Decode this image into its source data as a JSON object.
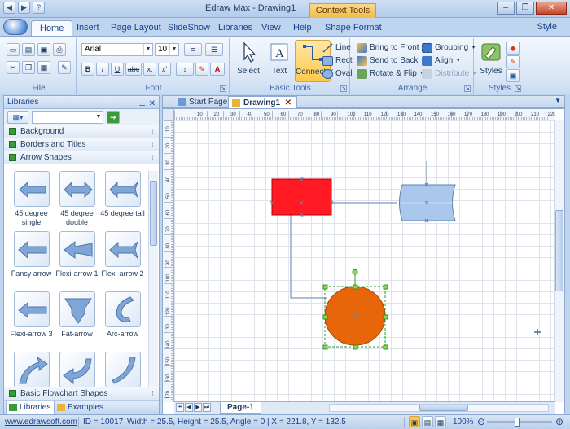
{
  "window": {
    "title": "Edraw Max - Drawing1",
    "context_tools": "Context Tools",
    "minimize": "–",
    "maximize": "❐",
    "close": "✕"
  },
  "qat": [
    "◀",
    "▶",
    "?"
  ],
  "tabs": [
    {
      "label": "Home",
      "active": true
    },
    {
      "label": "Insert"
    },
    {
      "label": "Page Layout"
    },
    {
      "label": "SlideShow"
    },
    {
      "label": "Libraries"
    },
    {
      "label": "View"
    },
    {
      "label": "Help"
    },
    {
      "label": "Shape Format"
    }
  ],
  "style_menu": "Style",
  "ribbon": {
    "file_label": "File",
    "font_label": "Font",
    "basic_tools_label": "Basic Tools",
    "arrange_label": "Arrange",
    "styles_label": "Styles",
    "font_name": "Arial",
    "font_size": "10",
    "bold": "B",
    "italic": "I",
    "underline": "U",
    "strike": "abc",
    "subscript": "x,",
    "superscript": "x'",
    "select_label": "Select",
    "text_label": "Text",
    "connector_label": "Connector",
    "line_label": "Line",
    "rect_label": "Rect",
    "oval_label": "Oval",
    "bring_front": "Bring to Front",
    "send_back": "Send to Back",
    "rotate_flip": "Rotate & Flip",
    "grouping": "Grouping",
    "align": "Align",
    "distribute": "Distribute",
    "styles_btn": "Styles"
  },
  "libraries": {
    "title": "Libraries",
    "pin": "⊥",
    "close": "✕",
    "categories": [
      "Background",
      "Borders and Titles",
      "Arrow Shapes"
    ],
    "bottom_category": "Basic Flowchart Shapes",
    "shapes": [
      "45 degree single",
      "45 degree double",
      "45 degree tail",
      "Fancy arrow",
      "Flexi-arrow 1",
      "Flexi-arrow 2",
      "Flexi-arrow 3",
      "Fat-arrow",
      "Arc-arrow",
      "",
      "",
      ""
    ],
    "tab_libraries": "Libraries",
    "tab_examples": "Examples"
  },
  "doc_tabs": [
    {
      "label": "Start Page"
    },
    {
      "label": "Drawing1",
      "active": true
    }
  ],
  "doc_tab_close": "✕",
  "page_tab": "Page-1",
  "rulers": {
    "h": [
      "10",
      "20",
      "30",
      "40",
      "50",
      "60",
      "70",
      "80",
      "90",
      "100",
      "110",
      "120",
      "130",
      "140",
      "150",
      "160",
      "170",
      "180",
      "190",
      "200",
      "210",
      "220"
    ],
    "v": [
      "10",
      "20",
      "30",
      "40",
      "50",
      "60",
      "70",
      "80",
      "90",
      "100",
      "110",
      "120",
      "130",
      "140",
      "150",
      "160",
      "170"
    ]
  },
  "status": {
    "website": "www.edrawsoft.com",
    "id": "ID = 10017",
    "geometry": "Width = 25.5, Height = 25.5, Angle = 0 | X = 221.8, Y = 132.5",
    "zoom": "100%"
  },
  "colors": {
    "rect_fill": "#ff1a24",
    "circle_fill": "#e8660a",
    "drum_fill": "#a9c8ec",
    "accent": "#ffc84a"
  }
}
